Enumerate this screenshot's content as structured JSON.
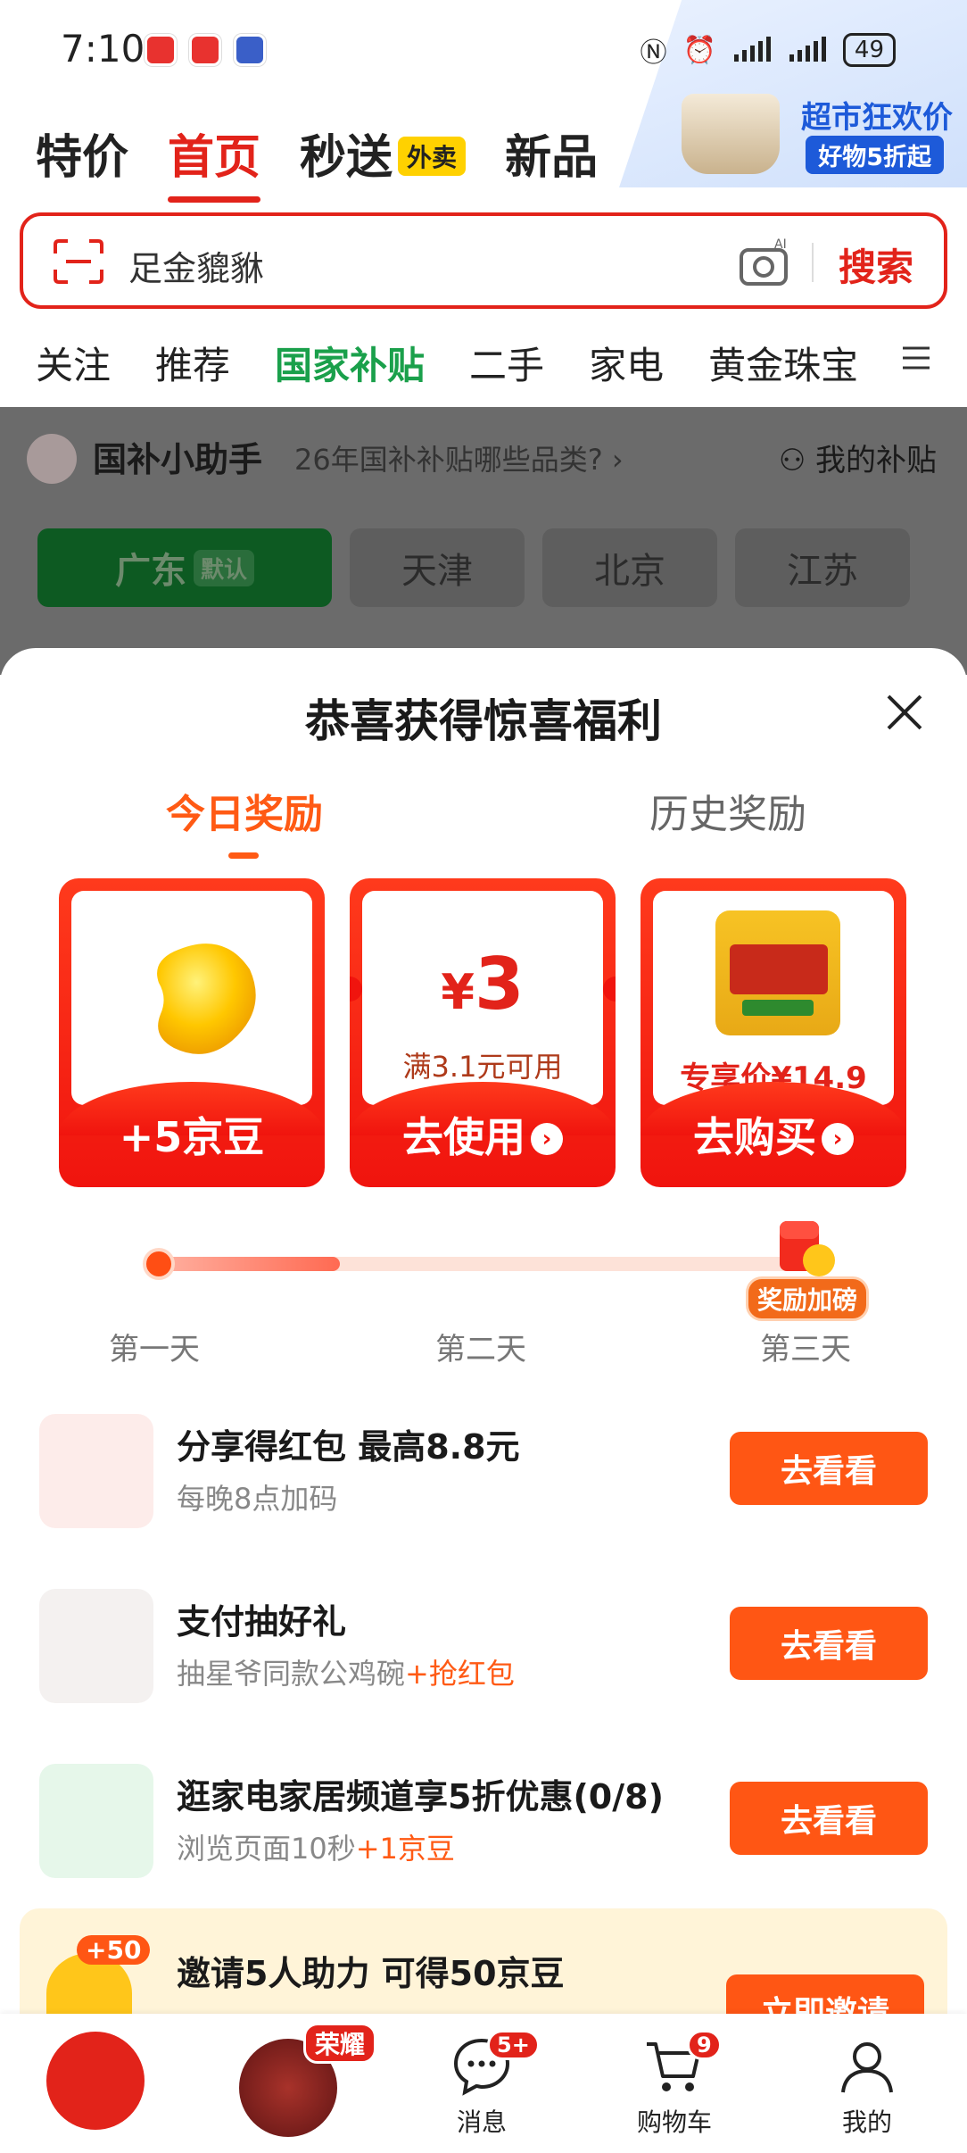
{
  "status_bar": {
    "time": "7:10",
    "battery": "49"
  },
  "top_ad": {
    "title": "超市狂欢价",
    "subtitle": "好物5折起"
  },
  "main_tabs": [
    {
      "label": "特价"
    },
    {
      "label": "首页"
    },
    {
      "label": "秒送",
      "badge": "外卖"
    },
    {
      "label": "新品"
    }
  ],
  "search": {
    "query": "足金貔貅",
    "ai_badge": "AI",
    "button": "搜索"
  },
  "categories": [
    "关注",
    "推荐",
    "国家补贴",
    "二手",
    "家电",
    "黄金珠宝"
  ],
  "helper": {
    "title": "国补小助手",
    "question": "26年国补补贴哪些品类?",
    "chevron": "›",
    "my_subsidy": "我的补贴"
  },
  "regions": [
    {
      "label": "广东",
      "tag": "默认"
    },
    {
      "label": "天津"
    },
    {
      "label": "北京"
    },
    {
      "label": "江苏"
    }
  ],
  "sheet": {
    "title": "恭喜获得惊喜福利",
    "tab_today": "今日奖励",
    "tab_history": "历史奖励"
  },
  "rewards": {
    "bean_cta": "+5京豆",
    "coupon_symbol": "¥",
    "coupon_amount": "3",
    "coupon_condition": "满3.1元可用",
    "coupon_cta": "去使用",
    "product_price": "专享价¥14.9",
    "product_cta": "去购买",
    "arrow": "›"
  },
  "progress": {
    "fraction": 0.28,
    "days": [
      "第一天",
      "第二天",
      "第三天"
    ],
    "bonus_label": "奖励加磅"
  },
  "tasks": [
    {
      "title": "分享得红包 最高8.8元",
      "sub": "每晚8点加码",
      "sub_highlight": "",
      "button": "去看看"
    },
    {
      "title": "支付抽好礼",
      "sub": "抽星爷同款公鸡碗",
      "sub_highlight": "+抢红包",
      "button": "去看看"
    },
    {
      "title": "逛家电家居频道享5折优惠(0/8)",
      "sub": "浏览页面10秒",
      "sub_highlight": "+1京豆",
      "button": "去看看"
    }
  ],
  "invite": {
    "badge": "+50",
    "title": "邀请5人助力 可得50京豆",
    "button": "立即邀请"
  },
  "bottom_nav": {
    "promo_badge": "荣耀",
    "messages_label": "消息",
    "messages_count": "5+",
    "cart_label": "购物车",
    "cart_count": "9",
    "me_label": "我的"
  },
  "colors": {
    "brand_red": "#e2231a",
    "accent_orange": "#ff5614",
    "subsidy_green": "#1aa04b"
  }
}
